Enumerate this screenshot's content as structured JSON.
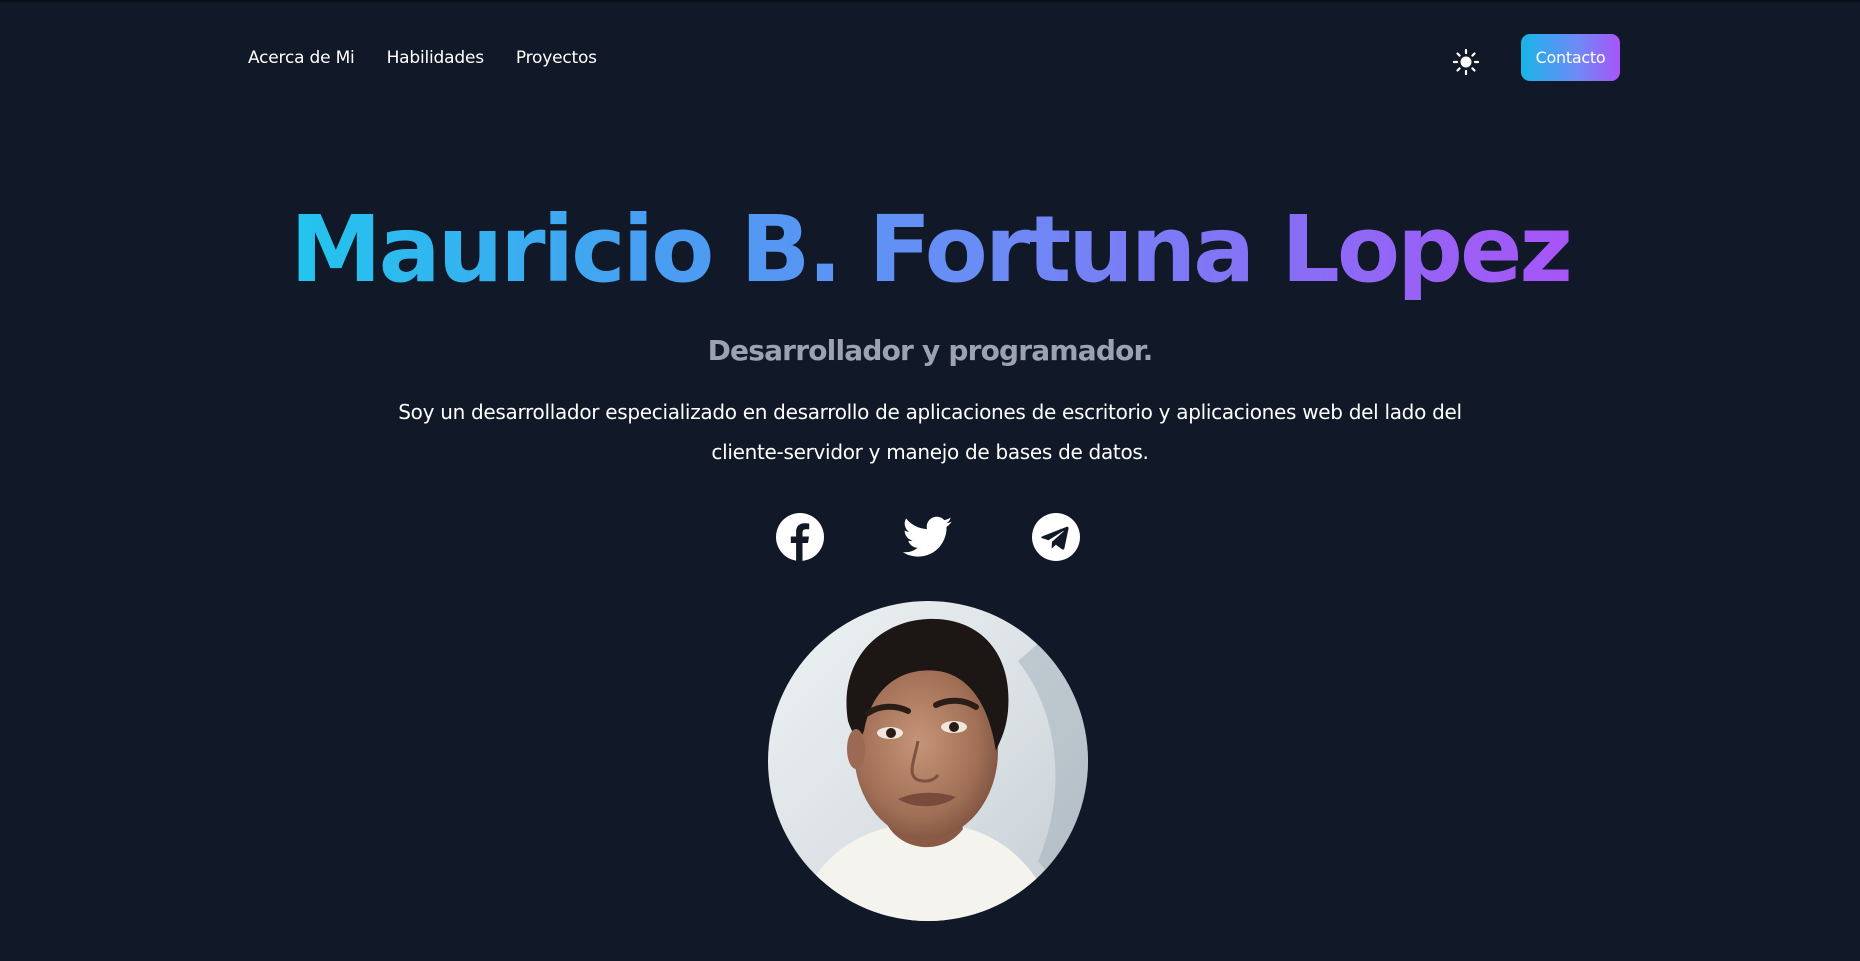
{
  "nav": {
    "items": [
      {
        "label": "Acerca de Mi"
      },
      {
        "label": "Habilidades"
      },
      {
        "label": "Proyectos"
      }
    ],
    "theme_icon": "sun-icon",
    "contact_label": "Contacto"
  },
  "hero": {
    "name": "Mauricio B. Fortuna Lopez",
    "subtitle": "Desarrollador y programador.",
    "description": "Soy un desarrollador especializado en desarrollo de aplicaciones de escritorio y aplicaciones web del lado del cliente-servidor y manejo de bases de datos."
  },
  "social": [
    {
      "icon": "facebook-icon"
    },
    {
      "icon": "twitter-icon"
    },
    {
      "icon": "telegram-icon"
    }
  ],
  "colors": {
    "background": "#111827",
    "gradient_start": "#22c5ee",
    "gradient_end": "#a855f7",
    "subtitle": "#9ca3af",
    "text": "#ffffff"
  }
}
